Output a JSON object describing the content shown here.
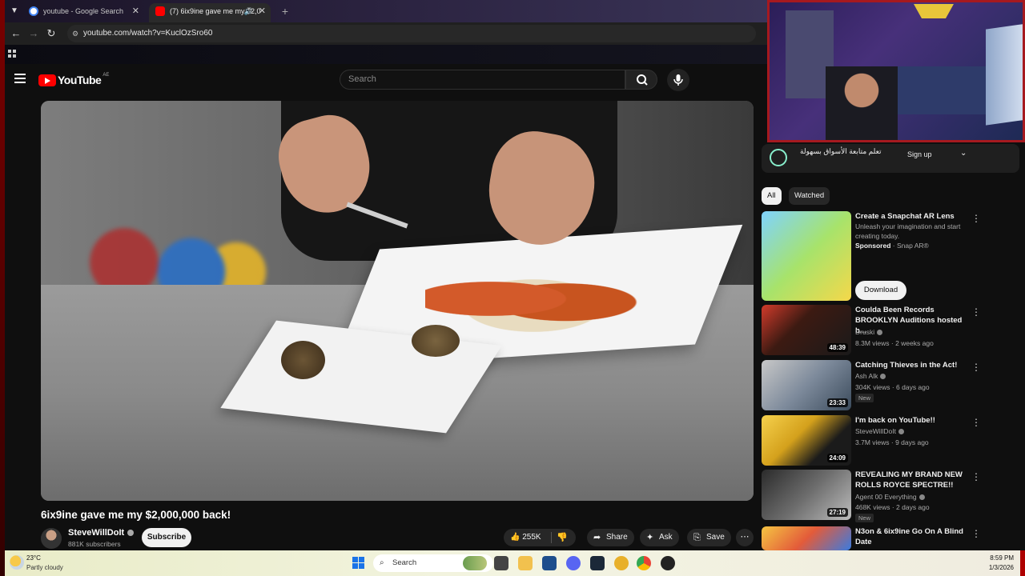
{
  "browser": {
    "tabs": [
      {
        "label": "youtube - Google Search"
      },
      {
        "label": "(7) 6ix9ine gave me my $2,0"
      }
    ],
    "url": "youtube.com/watch?v=KuclOzSro60"
  },
  "youtube": {
    "logo_text": "YouTube",
    "country_code": "AE",
    "search_placeholder": "Search"
  },
  "video": {
    "title": "6ix9ine gave me my $2,000,000 back!",
    "channel": "SteveWillDoIt",
    "subscribers": "881K subscribers",
    "subscribe_label": "Subscribe",
    "likes": "255K",
    "share_label": "Share",
    "ask_label": "Ask",
    "save_label": "Save"
  },
  "ad_banner": {
    "text": "تعلم متابعة الأسواق بسهولة",
    "signup_label": "Sign up"
  },
  "filter_chips": [
    "All",
    "Watched"
  ],
  "sponsored": {
    "title": "Create a Snapchat AR Lens",
    "description": "Unleash your imagination and start creating today.",
    "sponsored_label": "Sponsored",
    "advertiser": "Snap AR®",
    "download_label": "Download"
  },
  "recommendations": [
    {
      "title": "Coulda Been Records BROOKLYN Auditions hosted b...",
      "channel": "Druski",
      "meta": "8.3M views · 2 weeks ago",
      "duration": "48:39",
      "is_new": false
    },
    {
      "title": "Catching Thieves in the Act!",
      "channel": "Ash Alk",
      "meta": "304K views · 6 days ago",
      "duration": "23:33",
      "is_new": true
    },
    {
      "title": "I'm back on YouTube!!",
      "channel": "SteveWillDoIt",
      "meta": "3.7M views · 9 days ago",
      "duration": "24:09",
      "is_new": false
    },
    {
      "title": "REVEALING MY BRAND NEW ROLLS ROYCE SPECTRE!!",
      "channel": "Agent 00 Everything",
      "meta": "468K views · 2 days ago",
      "duration": "27:19",
      "is_new": true
    },
    {
      "title": "N3on & 6ix9ine Go On A Blind Date",
      "channel": "",
      "meta": "",
      "duration": "",
      "is_new": false
    }
  ],
  "new_label": "New",
  "taskbar": {
    "temperature": "23°C",
    "weather": "Partly cloudy",
    "search_label": "Search",
    "time": "8:59 PM",
    "date": "1/3/2026"
  }
}
